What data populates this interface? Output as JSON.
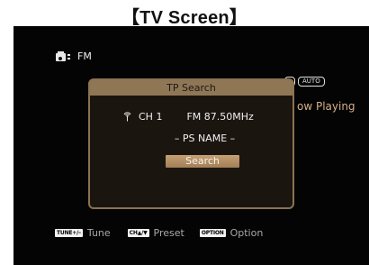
{
  "caption": "【TV Screen】",
  "source": {
    "icon": "radio-icon",
    "label": "FM"
  },
  "status_pills": [
    "",
    "AUTO"
  ],
  "now_playing": "ow Playing",
  "dialog": {
    "title": "TP Search",
    "channel_icon": "signal-icon",
    "channel": "CH 1",
    "frequency": "FM 87.50MHz",
    "ps_name": "– PS NAME –",
    "search_button": "Search"
  },
  "legend": [
    {
      "key": "TUNE+/–",
      "label": "Tune"
    },
    {
      "key": "CH▲/▼",
      "label": "Preset"
    },
    {
      "key": "OPTION",
      "label": "Option"
    }
  ],
  "colors": {
    "screen_bg": "#040404",
    "dialog_border": "#8a7252",
    "dialog_title_bg": "#8f7655",
    "button_bg": "#b38e63",
    "now_playing_text": "#d6b089"
  }
}
